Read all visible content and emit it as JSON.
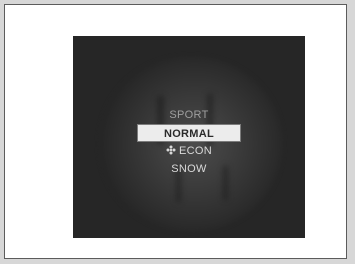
{
  "menu": {
    "items": [
      {
        "label": "SPORT",
        "state": "dim"
      },
      {
        "label": "NORMAL",
        "state": "selected"
      },
      {
        "label": "ECON",
        "state": "normal",
        "icon": "econ-leaf-icon"
      },
      {
        "label": "SNOW",
        "state": "normal"
      }
    ]
  }
}
